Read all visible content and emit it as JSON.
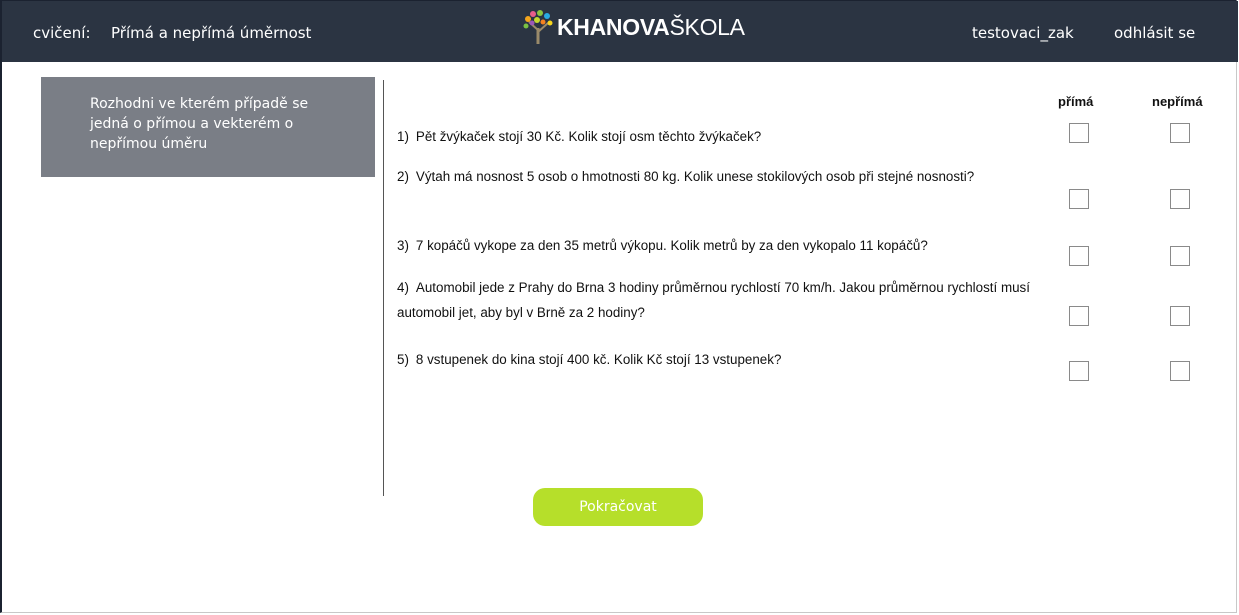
{
  "header": {
    "exercise_label": "cvičení:",
    "exercise_title": "Přímá a nepřímá úměrnost",
    "logo_bold": "KHANOVA",
    "logo_light": "ŠKOLA",
    "username": "testovaci_zak",
    "logout_label": "odhlásit se"
  },
  "instruction": "Rozhodni ve kterém případě se jedná o přímou a vekterém o nepřímou úměru",
  "columns": {
    "direct": "přímá",
    "inverse": "nepřímá"
  },
  "questions": [
    {
      "number": "1)",
      "text": "Pět žvýkaček stojí 30 Kč. Kolik stojí osm těchto žvýkaček?",
      "direct_checked": false,
      "inverse_checked": false
    },
    {
      "number": "2)",
      "text": "Výtah má nosnost 5 osob o hmotnosti 80 kg. Kolik unese stokilových osob při stejné nosnosti?",
      "direct_checked": false,
      "inverse_checked": false
    },
    {
      "number": "3)",
      "text": "7 kopáčů vykope za den 35 metrů výkopu. Kolik metrů by za den vykopalo 11 kopáčů?",
      "direct_checked": false,
      "inverse_checked": false
    },
    {
      "number": "4)",
      "text": "Automobil jede z Prahy do Brna 3 hodiny průměrnou rychlostí 70 km/h. Jakou průměrnou rychlostí musí automobil jet, aby byl v Brně za 2 hodiny?",
      "direct_checked": false,
      "inverse_checked": false
    },
    {
      "number": "5)",
      "text": "8 vstupenek do kina stojí 400 kč. Kolik Kč stojí 13 vstupenek?",
      "direct_checked": false,
      "inverse_checked": false
    }
  ],
  "continue_label": "Pokračovat",
  "colors": {
    "header_bg": "#2b3442",
    "instruction_bg": "#7a7e86",
    "button_bg": "#b6df2a"
  }
}
